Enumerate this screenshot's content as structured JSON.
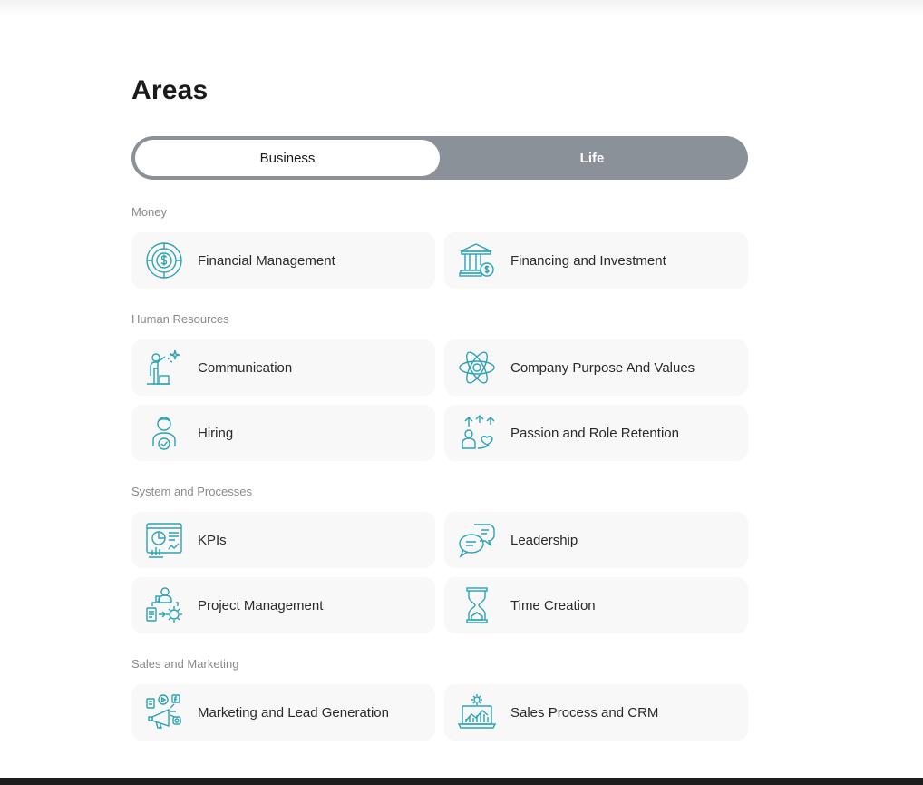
{
  "page": {
    "title": "Areas",
    "accent_color": "#2aa3b5"
  },
  "toggle": {
    "options": [
      {
        "label": "Business",
        "selected": true
      },
      {
        "label": "Life",
        "selected": false
      }
    ]
  },
  "sections": [
    {
      "label": "Money",
      "items": [
        {
          "label": "Financial Management",
          "icon": "financial-management-icon"
        },
        {
          "label": "Financing and Investment",
          "icon": "bank-investment-icon"
        }
      ]
    },
    {
      "label": "Human Resources",
      "items": [
        {
          "label": "Communication",
          "icon": "presenter-icon"
        },
        {
          "label": "Company Purpose And Values",
          "icon": "atom-icon"
        },
        {
          "label": "Hiring",
          "icon": "person-check-icon"
        },
        {
          "label": "Passion and Role Retention",
          "icon": "person-heart-icon"
        }
      ]
    },
    {
      "label": "System and Processes",
      "items": [
        {
          "label": "KPIs",
          "icon": "dashboard-chart-icon"
        },
        {
          "label": "Leadership",
          "icon": "chat-bubbles-icon"
        },
        {
          "label": "Project Management",
          "icon": "person-gear-icon"
        },
        {
          "label": "Time Creation",
          "icon": "hourglass-icon"
        }
      ]
    },
    {
      "label": "Sales and Marketing",
      "items": [
        {
          "label": "Marketing and Lead Generation",
          "icon": "megaphone-social-icon"
        },
        {
          "label": "Sales Process and CRM",
          "icon": "laptop-chart-icon"
        }
      ]
    }
  ]
}
